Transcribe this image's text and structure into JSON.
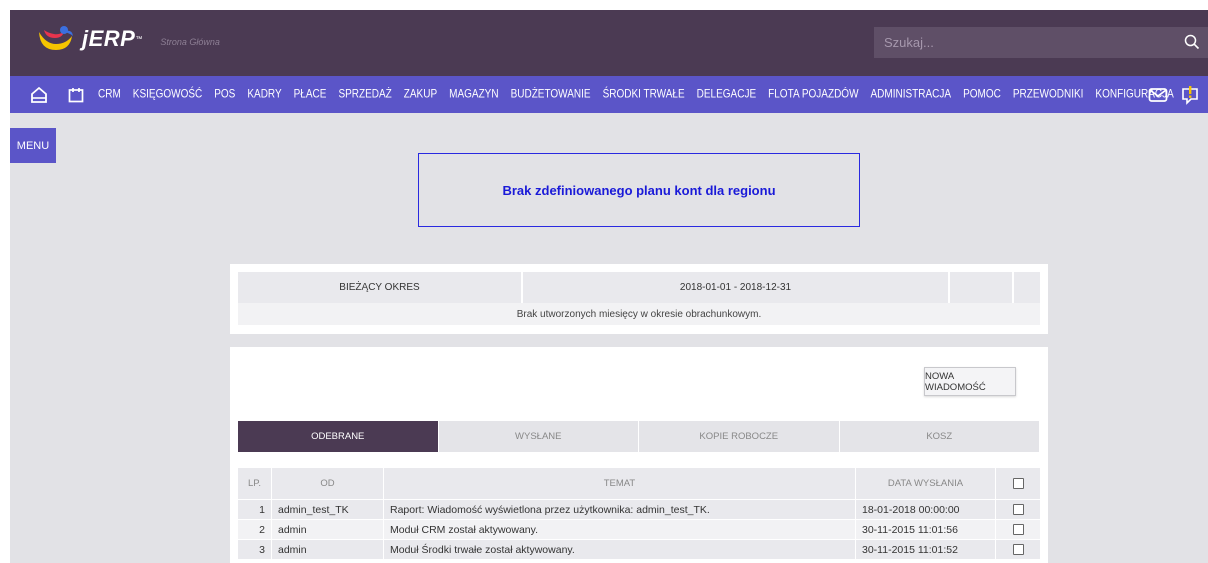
{
  "app": {
    "logo_text": "jERP",
    "logo_tm": "™",
    "subtitle": "Strona Główna",
    "brand_colors": {
      "topbar": "#4b3a53",
      "navbar": "#5b55c8",
      "accent_alert": "#1a1ad8"
    }
  },
  "search": {
    "placeholder": "Szukaj..."
  },
  "nav": {
    "items": [
      "CRM",
      "KSIĘGOWOŚĆ",
      "POS",
      "KADRY",
      "PŁACE",
      "SPRZEDAŻ",
      "ZAKUP",
      "MAGAZYN",
      "BUDŻETOWANIE",
      "ŚRODKI TRWAŁE",
      "DELEGACJE",
      "FLOTA POJAZDÓW",
      "ADMINISTRACJA",
      "POMOC",
      "PRZEWODNIKI",
      "KONFIGURACJA"
    ],
    "icons": [
      "home-icon",
      "calendar-icon",
      "mail-icon",
      "notification-icon"
    ]
  },
  "menu_button": "MENU",
  "alert": {
    "text": "Brak zdefiniowanego planu kont dla regionu"
  },
  "period": {
    "label": "BIEŻĄCY OKRES",
    "value": "2018-01-01 - 2018-12-31",
    "note": "Brak utworzonych miesięcy w okresie obrachunkowym."
  },
  "messages": {
    "new_button": "NOWA WIADOMOŚĆ",
    "tabs": [
      {
        "label": "ODEBRANE",
        "active": true
      },
      {
        "label": "WYSŁANE",
        "active": false
      },
      {
        "label": "KOPIE ROBOCZE",
        "active": false
      },
      {
        "label": "KOSZ",
        "active": false
      }
    ],
    "columns": {
      "lp": "LP.",
      "od": "OD",
      "temat": "TEMAT",
      "data": "DATA WYSŁANIA"
    },
    "rows": [
      {
        "lp": "1",
        "od": "admin_test_TK",
        "temat": "Raport: Wiadomość wyświetlona przez użytkownika: admin_test_TK.",
        "data": "18-01-2018 00:00:00"
      },
      {
        "lp": "2",
        "od": "admin",
        "temat": "Moduł CRM został aktywowany.",
        "data": "30-11-2015 11:01:56"
      },
      {
        "lp": "3",
        "od": "admin",
        "temat": "Moduł Środki trwałe został aktywowany.",
        "data": "30-11-2015 11:01:52"
      }
    ]
  }
}
